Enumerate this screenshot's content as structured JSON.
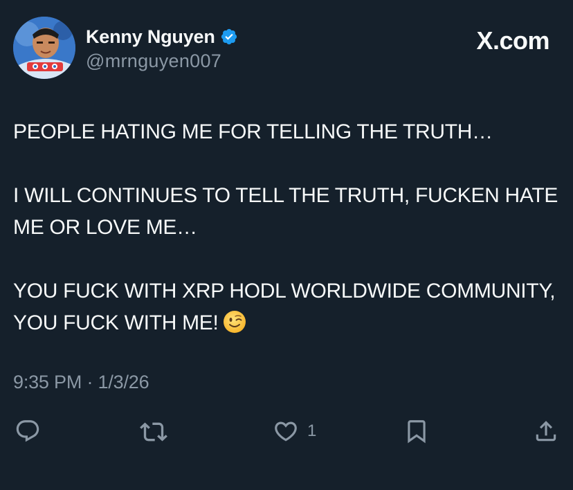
{
  "author": {
    "display_name": "Kenny Nguyen",
    "handle": "@mrnguyen007",
    "verified": true
  },
  "brand": "X.com",
  "tweet": {
    "paragraphs": [
      "PEOPLE HATING ME FOR TELLING THE TRUTH…",
      "I WILL CONTINUES TO TELL THE TRUTH, FUCKEN HATE ME OR LOVE ME…",
      "YOU FUCK WITH XRP HODL WORLDWIDE COMMUNITY, YOU FUCK WITH ME!"
    ],
    "trailing_emoji": "winking-face"
  },
  "meta": {
    "timestamp": "9:35 PM · 1/3/26"
  },
  "actions": {
    "reply_icon": "reply-icon",
    "retweet_icon": "retweet-icon",
    "like_icon": "like-icon",
    "like_count": "1",
    "bookmark_icon": "bookmark-icon",
    "share_icon": "share-icon"
  },
  "colors": {
    "background": "#15202b",
    "text_primary": "#f7f9f9",
    "text_secondary": "#8b98a5",
    "verified_blue": "#1d9bf0"
  }
}
